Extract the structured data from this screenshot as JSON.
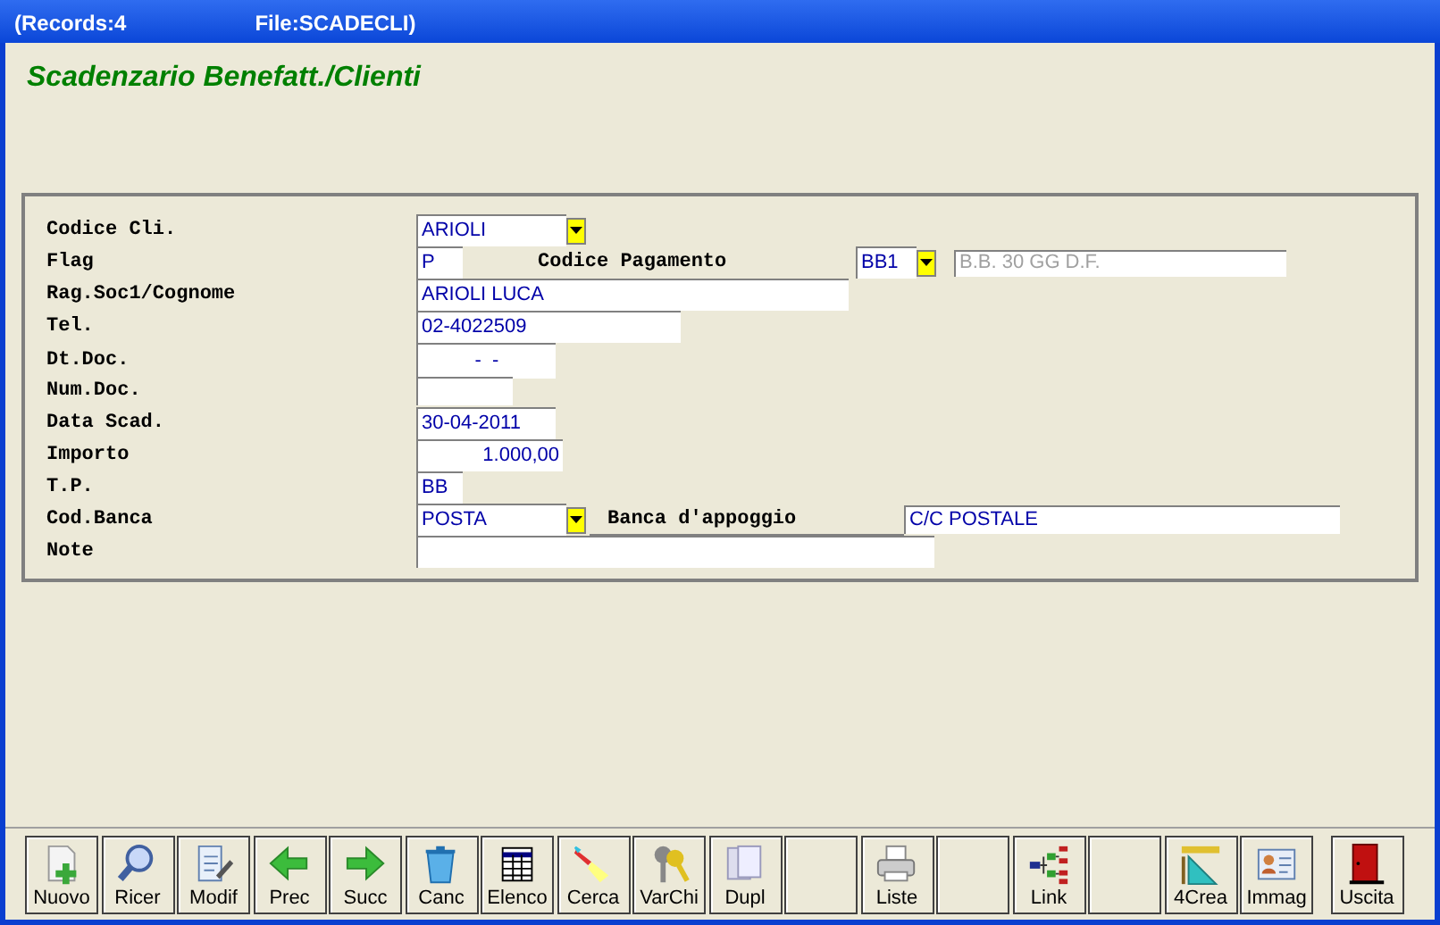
{
  "window": {
    "title_left": "(Records:4",
    "title_right": "File:SCADECLI)"
  },
  "form_title": "Scadenzario Benefatt./Clienti",
  "fields": [
    {
      "label": "Codice Cli.",
      "kind": "combo",
      "value": "ARIOLI"
    },
    {
      "label": "Flag",
      "kind": "text",
      "value": "P",
      "extra": {
        "kind": "payment",
        "label": "Codice Pagamento",
        "value": "BB1",
        "description": "B.B. 30 GG D.F.",
        "disabled": true
      }
    },
    {
      "label": "Rag.Soc1/Cognome",
      "kind": "text",
      "value": "ARIOLI LUCA"
    },
    {
      "label": "Tel.",
      "kind": "text",
      "value": "02-4022509"
    },
    {
      "label": "Dt.Doc.",
      "kind": "date",
      "value": "-  -"
    },
    {
      "label": "Num.Doc.",
      "kind": "text"
    },
    {
      "label": "Data Scad.",
      "kind": "text",
      "value": "30-04-2011"
    },
    {
      "label": "Importo",
      "kind": "number",
      "value": "1.000,00"
    },
    {
      "label": "T.P.",
      "kind": "text",
      "value": "BB"
    },
    {
      "label": "Cod.Banca",
      "kind": "combo",
      "value": "POSTA",
      "extra": {
        "kind": "bank",
        "label": "Banca d'appoggio",
        "value": "C/C POSTALE"
      }
    },
    {
      "label": "Note",
      "kind": "text"
    }
  ],
  "toolbar": [
    {
      "kind": "new",
      "label": "Nuovo"
    },
    {
      "kind": "search",
      "label": "Ricer"
    },
    {
      "kind": "edit",
      "label": "Modif"
    },
    {
      "kind": "prev",
      "label": "Prec"
    },
    {
      "kind": "next",
      "label": "Succ"
    },
    {
      "kind": "delete",
      "label": "Canc"
    },
    {
      "kind": "list",
      "label": "Elenco"
    },
    {
      "kind": "find",
      "label": "Cerca"
    },
    {
      "kind": "keys",
      "label": "VarChi"
    },
    {
      "kind": "copy",
      "label": "Dupl"
    },
    {
      "kind": "empty"
    },
    {
      "kind": "print",
      "label": "Liste"
    },
    {
      "kind": "empty"
    },
    {
      "kind": "link",
      "label": "Link"
    },
    {
      "kind": "empty"
    },
    {
      "kind": "create",
      "label": "4Crea"
    },
    {
      "kind": "image",
      "label": "Immag"
    },
    {
      "kind": "exit",
      "label": "Uscita"
    }
  ]
}
